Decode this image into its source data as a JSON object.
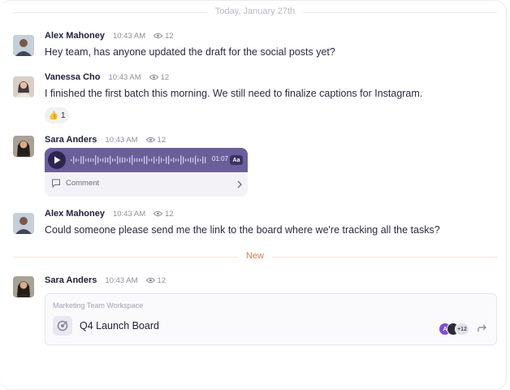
{
  "date_divider": "Today, January 27th",
  "new_divider": "New",
  "messages": [
    {
      "name": "Alex Mahoney",
      "time": "10:43 AM",
      "views": "12",
      "text": "Hey team, has anyone updated the draft for the social posts yet?"
    },
    {
      "name": "Vanessa Cho",
      "time": "10:43 AM",
      "views": "12",
      "text": "I finished the first batch this morning. We still need to finalize captions for Instagram.",
      "reaction": {
        "emoji": "👍",
        "count": "1"
      }
    },
    {
      "name": "Sara Anders",
      "time": "10:43 AM",
      "views": "12",
      "voice": {
        "duration": "01:07",
        "transcript_label": "Aa",
        "comment_label": "Comment"
      }
    },
    {
      "name": "Alex Mahoney",
      "time": "10:43 AM",
      "views": "12",
      "text": "Could someone please send me the link to the board where we're tracking all the tasks?"
    },
    {
      "name": "Sara Anders",
      "time": "10:43 AM",
      "views": "12",
      "card": {
        "workspace": "Marketing Team Workspace",
        "title": "Q4 Launch Board",
        "member_initial": "A",
        "member_extra": "+12"
      }
    }
  ],
  "colors": {
    "accent": "#6b5f99",
    "new": "#e07b4c",
    "member": "#7c4dd6"
  }
}
